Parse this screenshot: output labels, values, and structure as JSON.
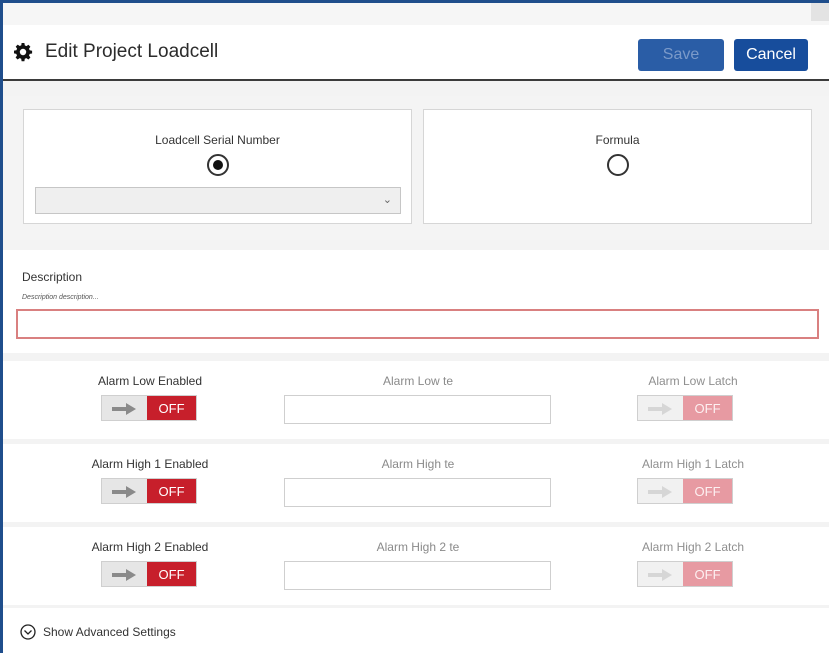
{
  "header": {
    "title": "Edit Project Loadcell",
    "icon": "gear-icon",
    "save_label": "Save",
    "cancel_label": "Cancel"
  },
  "source": {
    "serial_label": "Loadcell Serial Number",
    "serial_selected": true,
    "serial_select_value": "",
    "formula_label": "Formula",
    "formula_selected": false
  },
  "description": {
    "label": "Description",
    "sublabel": "Description description...",
    "value": ""
  },
  "alarms": [
    {
      "enabled_label": "Alarm Low Enabled",
      "enabled_state": "OFF",
      "value_label": "Alarm Low      te",
      "value": "",
      "latch_label": "Alarm Low Latch",
      "latch_state": "OFF"
    },
    {
      "enabled_label": "Alarm High 1 Enabled",
      "enabled_state": "OFF",
      "value_label": "Alarm High      te",
      "value": "",
      "latch_label": "Alarm High 1 Latch",
      "latch_state": "OFF"
    },
    {
      "enabled_label": "Alarm High 2 Enabled",
      "enabled_state": "OFF",
      "value_label": "Alarm High 2      te",
      "value": "",
      "latch_label": "Alarm High 2 Latch",
      "latch_state": "OFF"
    }
  ],
  "advanced": {
    "label": "Show Advanced Settings",
    "icon": "chevron-down-circle-icon"
  },
  "colors": {
    "accent": "#174d9c",
    "toggle_off": "#c71f2b",
    "invalid_border": "#d98080"
  }
}
